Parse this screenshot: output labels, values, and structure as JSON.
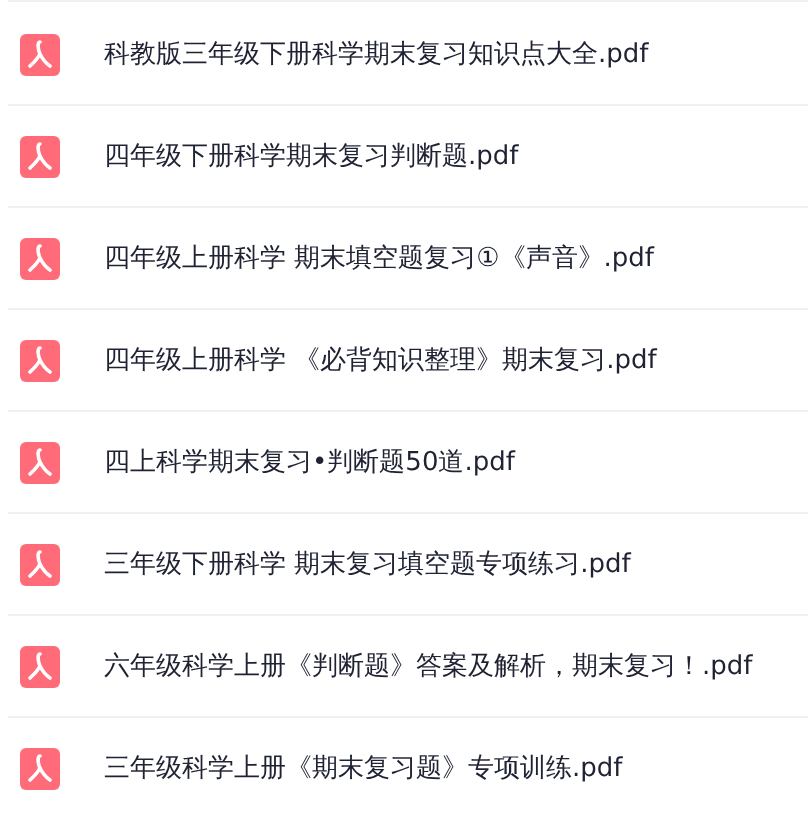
{
  "files": [
    {
      "name": "科教版三年级下册科学期末复习知识点大全.pdf"
    },
    {
      "name": "四年级下册科学期末复习判断题.pdf"
    },
    {
      "name": "四年级上册科学 期末填空题复习①《声音》.pdf"
    },
    {
      "name": "四年级上册科学 《必背知识整理》期末复习.pdf"
    },
    {
      "name": "四上科学期末复习•判断题50道.pdf"
    },
    {
      "name": "三年级下册科学 期末复习填空题专项练习.pdf"
    },
    {
      "name": "六年级科学上册《判断题》答案及解析，期末复习！.pdf"
    },
    {
      "name": "三年级科学上册《期末复习题》专项训练.pdf"
    }
  ]
}
